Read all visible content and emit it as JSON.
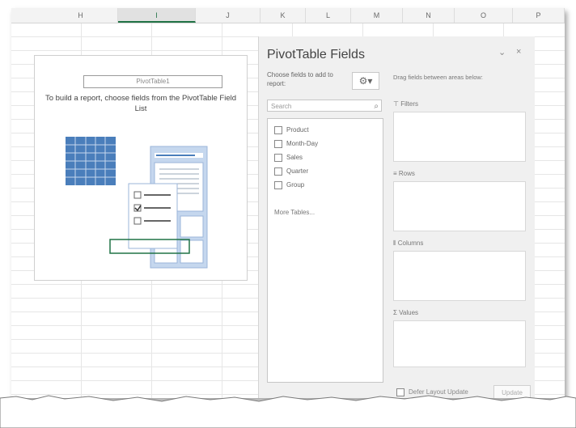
{
  "columns": [
    "K",
    "L",
    "M",
    "N",
    "O",
    "P",
    "",
    "",
    ""
  ],
  "column_headers": [
    {
      "label": "H",
      "selected": false
    },
    {
      "label": "I",
      "selected": true
    },
    {
      "label": "J",
      "selected": false
    },
    {
      "label": "K",
      "selected": false
    },
    {
      "label": "L",
      "selected": false
    },
    {
      "label": "M",
      "selected": false
    },
    {
      "label": "N",
      "selected": false
    },
    {
      "label": "O",
      "selected": false
    },
    {
      "label": "P",
      "selected": false
    }
  ],
  "placeholder": {
    "name_box": "PivotTable1",
    "message": "To build a report, choose fields from the PivotTable Field List"
  },
  "pane": {
    "title": "PivotTable Fields",
    "chevron": "⌄",
    "close": "×",
    "choose_label": "Choose fields to add to report:",
    "search_placeholder": "Search",
    "fields": [
      "Product",
      "Month-Day",
      "Sales",
      "Quarter",
      "Group"
    ],
    "more_tables": "More Tables...",
    "drag_hint": "Drag fields between areas below:",
    "areas": {
      "filters": "Filters",
      "rows": "Rows",
      "columns": "Columns",
      "values": "Values"
    },
    "defer_label": "Defer Layout Update",
    "update_label": "Update"
  },
  "colors": {
    "accent": "#217346",
    "illustration_blue": "#4a7ebb",
    "illustration_light": "#c5d7ee"
  }
}
